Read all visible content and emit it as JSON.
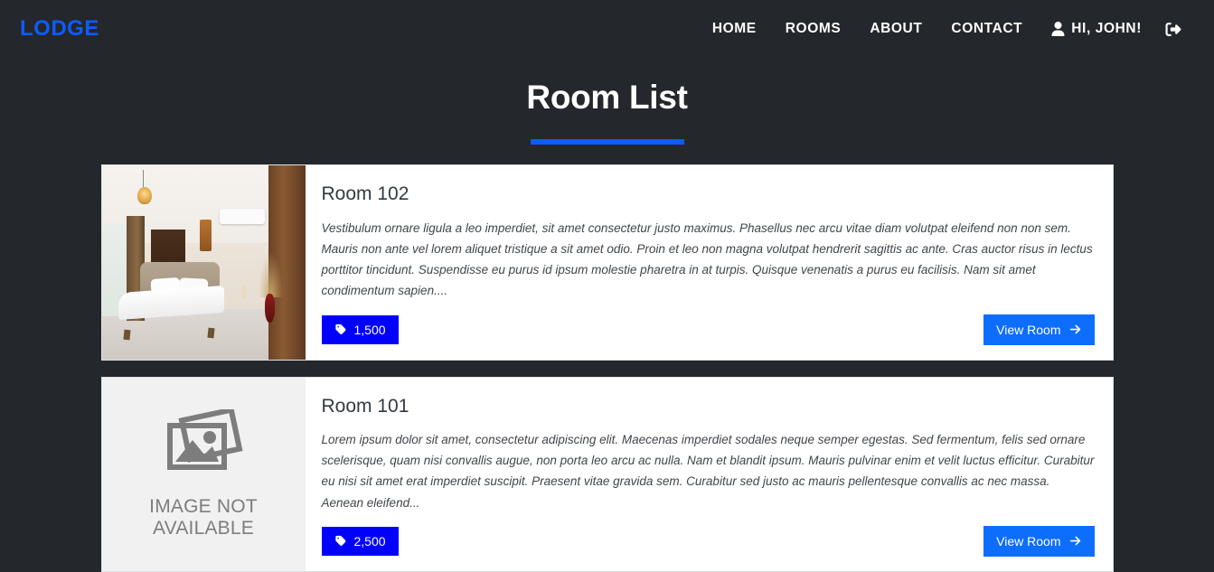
{
  "navbar": {
    "brand": "LODGE",
    "links": [
      {
        "label": "HOME"
      },
      {
        "label": "ROOMS"
      },
      {
        "label": "ABOUT"
      },
      {
        "label": "CONTACT"
      }
    ],
    "user_greeting": "HI, JOHN!",
    "user_icon": "user-icon",
    "logout_icon": "sign-out-icon",
    "brand_color": "#0d5cfd"
  },
  "page": {
    "title": "Room List",
    "accent_color": "#0d5cfd",
    "background_color": "#24272b"
  },
  "rooms": [
    {
      "name": "Room 102",
      "description": "Vestibulum ornare ligula a leo imperdiet, sit amet consectetur justo maximus. Phasellus nec arcu vitae diam volutpat eleifend non non sem. Mauris non ante vel lorem aliquet tristique a sit amet odio. Proin et leo non magna volutpat hendrerit sagittis ac ante. Cras auctor risus in lectus porttitor tincidunt. Suspendisse eu purus id ipsum molestie pharetra in at turpis. Quisque venenatis a purus eu facilisis. Nam sit amet condimentum sapien....",
      "price": "1,500",
      "price_icon": "tag-icon",
      "button_label": "View Room",
      "button_icon": "arrow-right-icon",
      "media": "photo",
      "media_alt": "hotel bedroom photo"
    },
    {
      "name": "Room 101",
      "description": "Lorem ipsum dolor sit amet, consectetur adipiscing elit. Maecenas imperdiet sodales neque semper egestas. Sed fermentum, felis sed ornare scelerisque, quam nisi convallis augue, non porta leo arcu ac nulla. Nam et blandit ipsum. Mauris pulvinar enim et velit luctus efficitur. Curabitur eu nisi sit amet erat imperdiet suscipit. Praesent vitae gravida sem. Curabitur sed justo ac mauris pellentesque convallis ac nec massa. Aenean eleifend...",
      "price": "2,500",
      "price_icon": "tag-icon",
      "button_label": "View Room",
      "button_icon": "arrow-right-icon",
      "media": "placeholder",
      "placeholder_line1": "IMAGE NOT",
      "placeholder_line2": "AVAILABLE",
      "placeholder_icon": "broken-image-icon"
    }
  ]
}
